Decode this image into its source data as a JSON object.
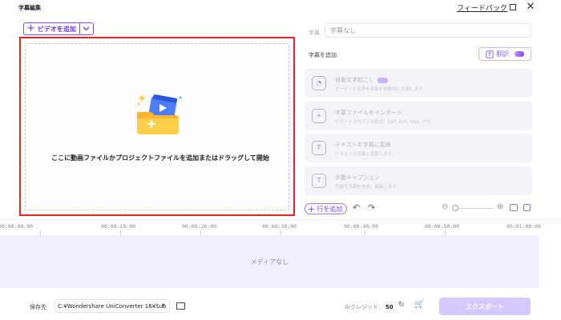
{
  "window": {
    "title": "字幕編集",
    "feedback_link": "フィードバック",
    "close_glyph": "✕"
  },
  "left_panel": {
    "add_video_label": "ビデオを追加",
    "drop_text": "ここに動画ファイルかプロジェクトファイルを追加またはドラッグして開始"
  },
  "right_panel": {
    "subtitle_label": "字幕",
    "subtitle_value": "字幕なし",
    "add_subtitle_title": "字幕を追加",
    "translate_label": "翻訳",
    "options": [
      {
        "title": "自動文字起こし",
        "desc": "オーディオ音声を字幕を自動的に生成します。",
        "ai": true,
        "icon": "auto-transcribe-icon"
      },
      {
        "title": "字幕ファイルをインポート",
        "desc": "サポートされている形式：SRT, ASS, SSA, VTT。",
        "ai": false,
        "icon": "import-icon"
      },
      {
        "title": "テキストを字幕に変換",
        "desc": "テキストを字幕に変換します。",
        "ai": false,
        "icon": "text-to-subtitle-icon"
      },
      {
        "title": "手動キャプション",
        "desc": "手動で字幕を作成、編集します。",
        "ai": false,
        "icon": "manual-caption-icon"
      }
    ]
  },
  "timeline": {
    "add_row_label": "行を追加",
    "ticks": [
      "00:00:00:00",
      "00:00:10:00",
      "00:00:20:00",
      "00:00:30:00",
      "00:00:40:00",
      "00:00:50:00",
      "00:01:00:00"
    ],
    "empty_text": "メディアなし"
  },
  "bottom": {
    "save_label": "保存先",
    "save_path": "C:¥Wondershare UniConverter 16¥Sub",
    "credit_label": "AIクレジット：",
    "credit_value": "50",
    "export_label": "エクスポート"
  },
  "colors": {
    "accent": "#7c4dff",
    "highlight_frame": "#e12626",
    "export_disabled": "#d5c8ff",
    "timeline_bg": "#f1eff9"
  }
}
